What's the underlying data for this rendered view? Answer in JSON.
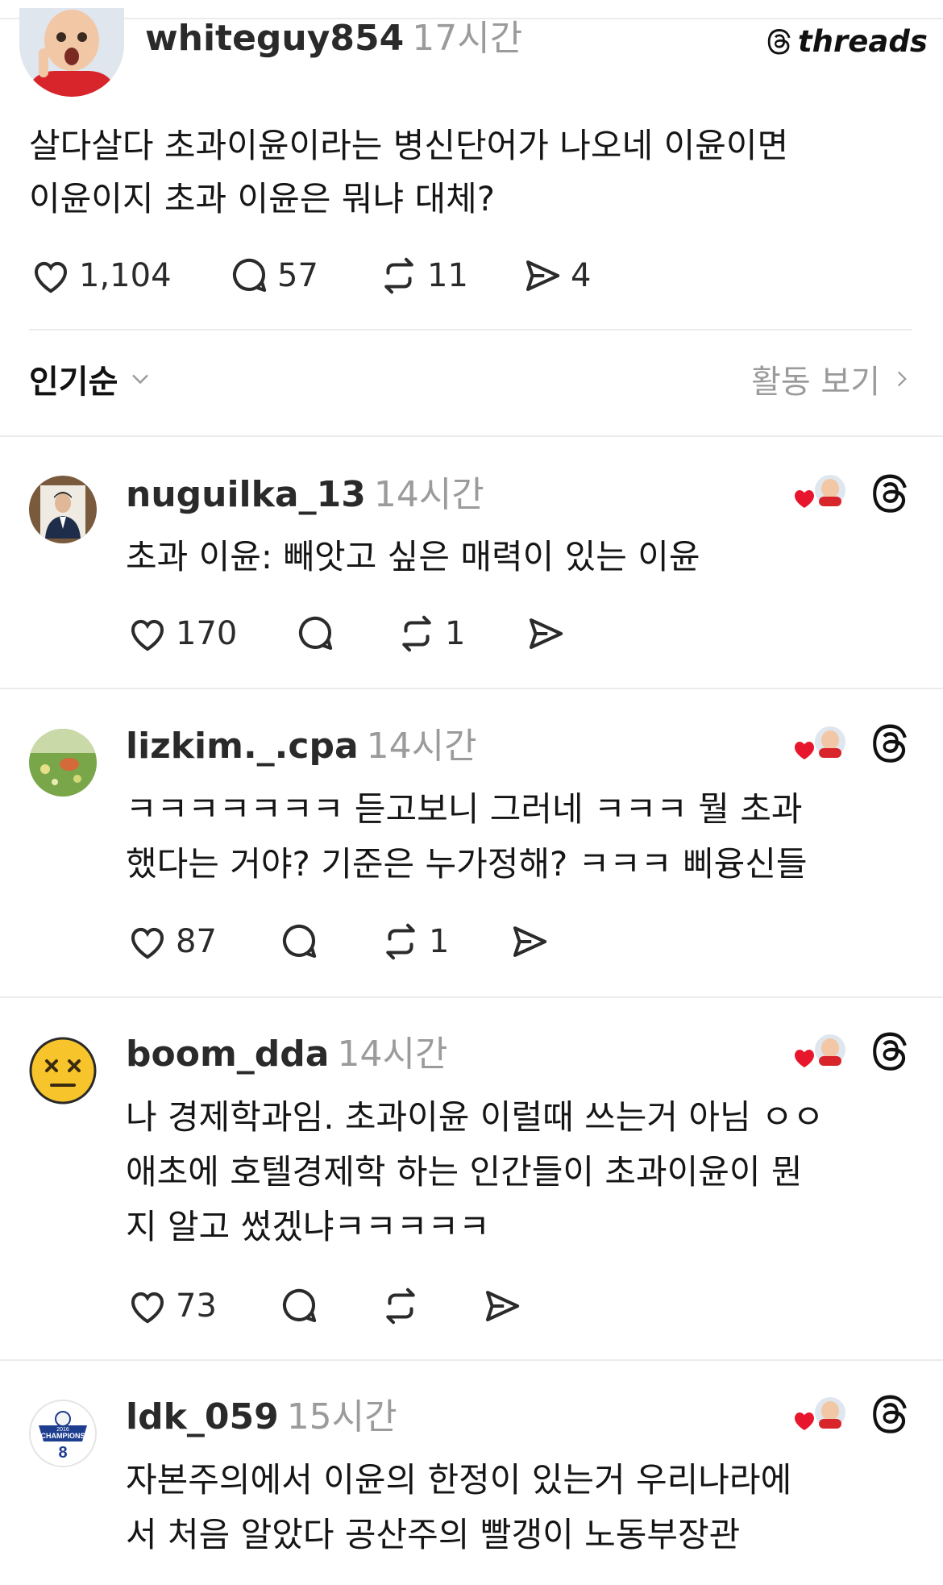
{
  "brand": {
    "name": "threads"
  },
  "main_post": {
    "username": "whiteguy854",
    "time": "17시간",
    "text_lines": [
      "살다살다 초과이윤이라는 병신단어가 나오네 이윤이면",
      "이윤이지 초과 이윤은 뭐냐 대체?"
    ],
    "likes": "1,104",
    "comments": "57",
    "reposts": "11",
    "shares": "4"
  },
  "sort": {
    "label": "인기순",
    "activity_label": "활동 보기"
  },
  "replies": [
    {
      "username": "nuguilka_13",
      "time": "14시간",
      "lines": [
        "초과 이윤: 빼앗고 싶은 매력이 있는 이윤"
      ],
      "likes": "170",
      "comments": "",
      "reposts": "1"
    },
    {
      "username": "lizkim._.cpa",
      "time": "14시간",
      "lines": [
        "ㅋㅋㅋㅋㅋㅋㅋ 듣고보니 그러네 ㅋㅋㅋ 뭘 초과",
        "했다는 거야? 기준은 누가정해? ㅋㅋㅋ 삐융신들"
      ],
      "likes": "87",
      "comments": "",
      "reposts": "1"
    },
    {
      "username": "boom_dda",
      "time": "14시간",
      "lines": [
        "나 경제학과임. 초과이윤 이럴때 쓰는거 아님 ㅇㅇ",
        "애초에 호텔경제학 하는 인간들이 초과이윤이 뭔",
        "지 알고 썼겠냐ㅋㅋㅋㅋㅋ"
      ],
      "likes": "73",
      "comments": "",
      "reposts": ""
    },
    {
      "username": "ldk_059",
      "time": "15시간",
      "lines": [
        "자본주의에서 이윤의 한정이 있는거 우리나라에",
        "서 처음 알았다 공산주의 빨갱이 노동부장관"
      ],
      "badge_text": [
        "2016",
        "CHAMPIONS",
        "8"
      ]
    }
  ]
}
